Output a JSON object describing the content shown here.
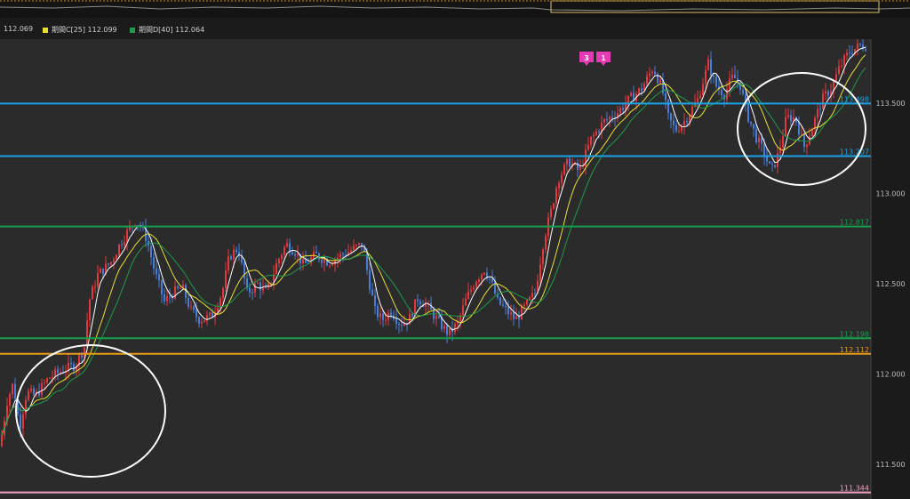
{
  "colors": {
    "background": "#2b2b2b",
    "bull": "#e0393e",
    "bear": "#4a7dd8",
    "ma_short": "#ffffff",
    "ma_mid": "#e8e030",
    "ma_long": "#1e9a4a",
    "line_blue": "#1aa3e8",
    "line_green": "#15a04c",
    "line_orange": "#e89a1a",
    "line_pink": "#f0a0c8",
    "marker": "#e83ab6"
  },
  "legend": {
    "item1": {
      "text": "112.069"
    },
    "item2": {
      "text": "期間C[25] 112.099",
      "color": "#e8e030"
    },
    "item3": {
      "text": "期間D[40] 112.064",
      "color": "#1e9a4a"
    }
  },
  "markers": [
    {
      "label": "3",
      "icon": "event-marker"
    },
    {
      "label": "1",
      "icon": "event-marker"
    }
  ],
  "chart_data": {
    "type": "candlestick",
    "y_axis": {
      "ticks": [
        "113.500",
        "113.000",
        "112.500",
        "112.000",
        "111.500"
      ],
      "range": [
        111.34,
        113.85
      ],
      "position": "right"
    },
    "horizontal_lines": [
      {
        "price": 113.498,
        "label": "113.498",
        "color": "#1aa3e8"
      },
      {
        "price": 113.207,
        "label": "113.207",
        "color": "#1aa3e8"
      },
      {
        "price": 112.817,
        "label": "112.817",
        "color": "#15a04c"
      },
      {
        "price": 112.198,
        "label": "112.198",
        "color": "#15a04c"
      },
      {
        "price": 112.112,
        "label": "112.112",
        "color": "#e89a1a"
      },
      {
        "price": 111.344,
        "label": "111.344",
        "color": "#f0a0c8"
      }
    ],
    "price_path": [
      [
        0,
        111.6
      ],
      [
        8,
        111.85
      ],
      [
        15,
        111.95
      ],
      [
        22,
        111.7
      ],
      [
        30,
        111.9
      ],
      [
        40,
        111.88
      ],
      [
        55,
        111.98
      ],
      [
        70,
        112.02
      ],
      [
        85,
        112.05
      ],
      [
        95,
        112.15
      ],
      [
        100,
        112.4
      ],
      [
        110,
        112.55
      ],
      [
        125,
        112.62
      ],
      [
        135,
        112.72
      ],
      [
        145,
        112.8
      ],
      [
        152,
        112.85
      ],
      [
        158,
        112.82
      ],
      [
        165,
        112.75
      ],
      [
        175,
        112.55
      ],
      [
        185,
        112.4
      ],
      [
        195,
        112.45
      ],
      [
        205,
        112.48
      ],
      [
        215,
        112.35
      ],
      [
        225,
        112.3
      ],
      [
        238,
        112.32
      ],
      [
        250,
        112.45
      ],
      [
        258,
        112.65
      ],
      [
        268,
        112.7
      ],
      [
        278,
        112.45
      ],
      [
        290,
        112.5
      ],
      [
        300,
        112.45
      ],
      [
        312,
        112.62
      ],
      [
        322,
        112.72
      ],
      [
        332,
        112.68
      ],
      [
        342,
        112.6
      ],
      [
        355,
        112.66
      ],
      [
        370,
        112.62
      ],
      [
        385,
        112.66
      ],
      [
        400,
        112.7
      ],
      [
        408,
        112.72
      ],
      [
        415,
        112.52
      ],
      [
        422,
        112.35
      ],
      [
        430,
        112.3
      ],
      [
        440,
        112.35
      ],
      [
        450,
        112.28
      ],
      [
        460,
        112.3
      ],
      [
        470,
        112.42
      ],
      [
        480,
        112.38
      ],
      [
        495,
        112.28
      ],
      [
        505,
        112.22
      ],
      [
        515,
        112.28
      ],
      [
        525,
        112.42
      ],
      [
        535,
        112.52
      ],
      [
        545,
        112.58
      ],
      [
        552,
        112.52
      ],
      [
        560,
        112.4
      ],
      [
        570,
        112.35
      ],
      [
        580,
        112.3
      ],
      [
        592,
        112.38
      ],
      [
        602,
        112.45
      ],
      [
        612,
        112.75
      ],
      [
        620,
        112.9
      ],
      [
        628,
        113.08
      ],
      [
        640,
        113.18
      ],
      [
        652,
        113.12
      ],
      [
        665,
        113.3
      ],
      [
        680,
        113.4
      ],
      [
        695,
        113.45
      ],
      [
        708,
        113.52
      ],
      [
        722,
        113.58
      ],
      [
        735,
        113.7
      ],
      [
        745,
        113.58
      ],
      [
        752,
        113.42
      ],
      [
        760,
        113.35
      ],
      [
        770,
        113.4
      ],
      [
        785,
        113.52
      ],
      [
        797,
        113.72
      ],
      [
        805,
        113.6
      ],
      [
        815,
        113.55
      ],
      [
        825,
        113.65
      ],
      [
        833,
        113.6
      ],
      [
        840,
        113.45
      ],
      [
        850,
        113.32
      ],
      [
        860,
        113.22
      ],
      [
        868,
        113.12
      ],
      [
        876,
        113.22
      ],
      [
        885,
        113.42
      ],
      [
        895,
        113.42
      ],
      [
        905,
        113.26
      ],
      [
        915,
        113.38
      ],
      [
        925,
        113.52
      ],
      [
        935,
        113.58
      ],
      [
        945,
        113.7
      ],
      [
        955,
        113.78
      ],
      [
        968,
        113.82
      ]
    ],
    "ma_short_offset": 0.0,
    "annotations": [
      {
        "shape": "ellipse",
        "area": "lower-left"
      },
      {
        "shape": "ellipse",
        "area": "upper-right"
      }
    ]
  }
}
